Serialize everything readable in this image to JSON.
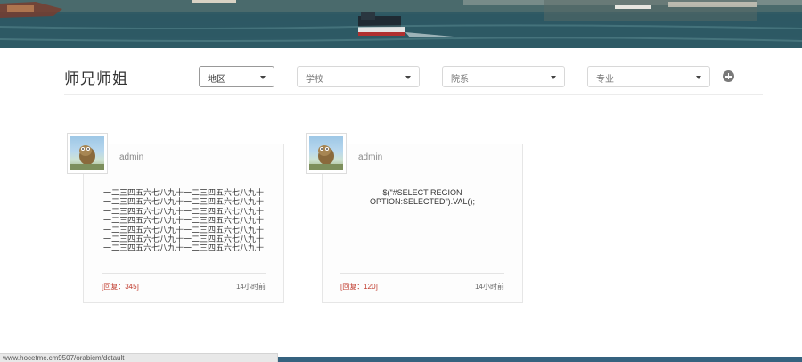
{
  "page": {
    "title": "师兄师姐"
  },
  "filters": [
    {
      "name": "region-select",
      "label": "地区"
    },
    {
      "name": "school-select",
      "label": "学校"
    },
    {
      "name": "college-select",
      "label": "院系"
    },
    {
      "name": "major-select",
      "label": "专业"
    }
  ],
  "cards": [
    {
      "username": "admin",
      "content": "一二三四五六七八九十一二三四五六七八九十\n一二三四五六七八九十一二三四五六七八九十\n一二三四五六七八九十一二三四五六七八九十\n一二三四五六七八九十一二三四五六七八九十\n一二三四五六七八九十一二三四五六七八九十\n一二三四五六七八九十一二三四五六七八九十\n一二三四五六七八九十一二三四五六七八九十",
      "reply": "[回复：345]",
      "time": "14小时前"
    },
    {
      "username": "admin",
      "content": "$(\"#SELECT REGION\nOPTION:SELECTED\").VAL();",
      "reply": "[回复：120]",
      "time": "14小时前"
    }
  ],
  "status_bar": {
    "url": "www.hocetmc.cm9507/orabicm/dctault"
  },
  "colors": {
    "reply_red": "#c0392b",
    "footer_blue": "#35627f"
  },
  "icons": {
    "add": "plus-circle-icon",
    "dropdown": "caret-down-icon"
  }
}
